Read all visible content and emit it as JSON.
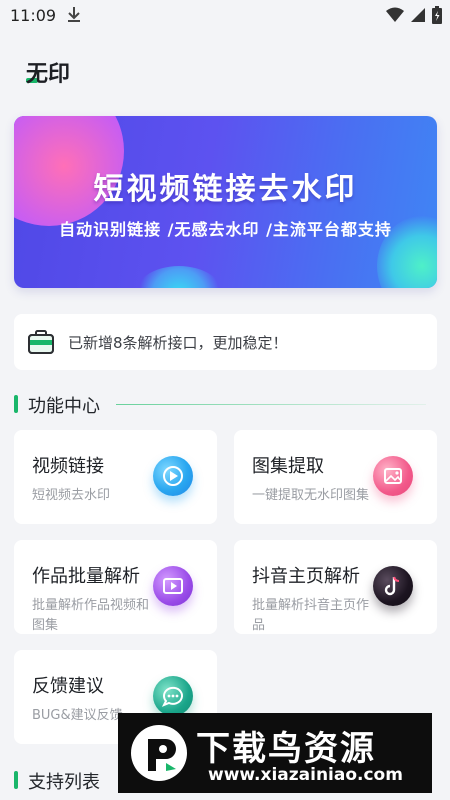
{
  "status_bar": {
    "time": "11:09"
  },
  "app": {
    "title": "无印"
  },
  "banner": {
    "title": "短视频链接去水印",
    "subtitle": "自动识别链接 /无感去水印 /主流平台都支持"
  },
  "notice": {
    "text": "已新增8条解析接口，更加稳定！"
  },
  "sections": {
    "features": "功能中心",
    "support": "支持列表"
  },
  "cards": [
    {
      "title": "视频链接",
      "desc": "短视频去水印",
      "icon": "play-icon",
      "color": "#2aa7f0"
    },
    {
      "title": "图集提取",
      "desc": "一键提取无水印图集",
      "icon": "image-icon",
      "color": "#f2598a"
    },
    {
      "title": "作品批量解析",
      "desc": "批量解析作品视频和图集",
      "icon": "video-list-icon",
      "color": "#9a4be8"
    },
    {
      "title": "抖音主页解析",
      "desc": "批量解析抖音主页作品",
      "icon": "tiktok-icon",
      "color": "#1c1420"
    },
    {
      "title": "反馈建议",
      "desc": "BUG&建议反馈",
      "icon": "chat-icon",
      "color": "#1aa58a"
    }
  ],
  "watermark": {
    "brand": "下载鸟资源",
    "url": "www.xiazainiao.com"
  },
  "colors": {
    "accent": "#19b66a",
    "background": "#f3f4f7"
  }
}
